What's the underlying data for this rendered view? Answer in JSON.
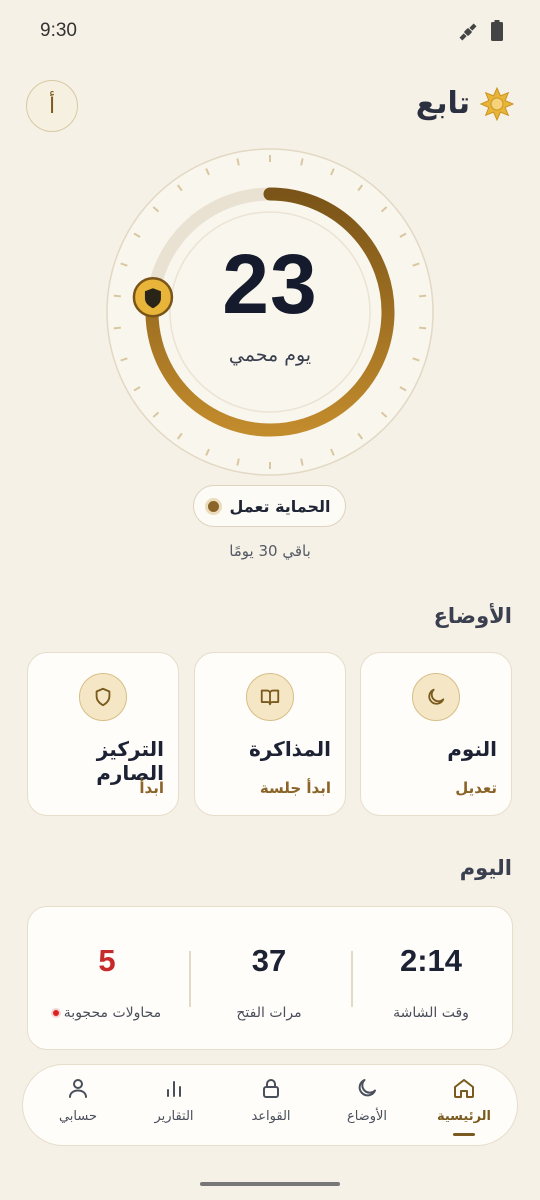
{
  "status_bar": {
    "time": "9:30"
  },
  "header": {
    "lang_button": "أ",
    "brand_title": "تابع"
  },
  "protection": {
    "days_count": "23",
    "days_caption": "يوم محمي",
    "progress": 0.77,
    "status_label": "الحماية تعمل",
    "remaining": "باقي 30 يومًا"
  },
  "modes": {
    "title": "الأوضاع",
    "items": [
      {
        "name": "النوم",
        "action": "تعديل",
        "icon": "moon-icon"
      },
      {
        "name": "المذاكرة",
        "action": "ابدأ جلسة",
        "icon": "book-icon"
      },
      {
        "name": "التركيز الصارم",
        "action": "ابدأ",
        "icon": "shield-icon"
      }
    ]
  },
  "today": {
    "title": "اليوم",
    "stats": [
      {
        "value": "2:14",
        "label": "وقت الشاشة"
      },
      {
        "value": "37",
        "label": "مرات الفتح"
      },
      {
        "value": "5",
        "label": "محاولات محجوبة"
      }
    ]
  },
  "nav": {
    "items": [
      {
        "label": "الرئيسية",
        "icon": "home-icon",
        "active": true
      },
      {
        "label": "الأوضاع",
        "icon": "moon-icon"
      },
      {
        "label": "القواعد",
        "icon": "lock-icon"
      },
      {
        "label": "التقارير",
        "icon": "bar-chart-icon"
      },
      {
        "label": "حسابي",
        "icon": "user-icon"
      }
    ]
  },
  "colors": {
    "accent": "#8a6428",
    "gold": "#e8b43a",
    "background": "#f6f1e6",
    "danger": "#c62a2a"
  }
}
